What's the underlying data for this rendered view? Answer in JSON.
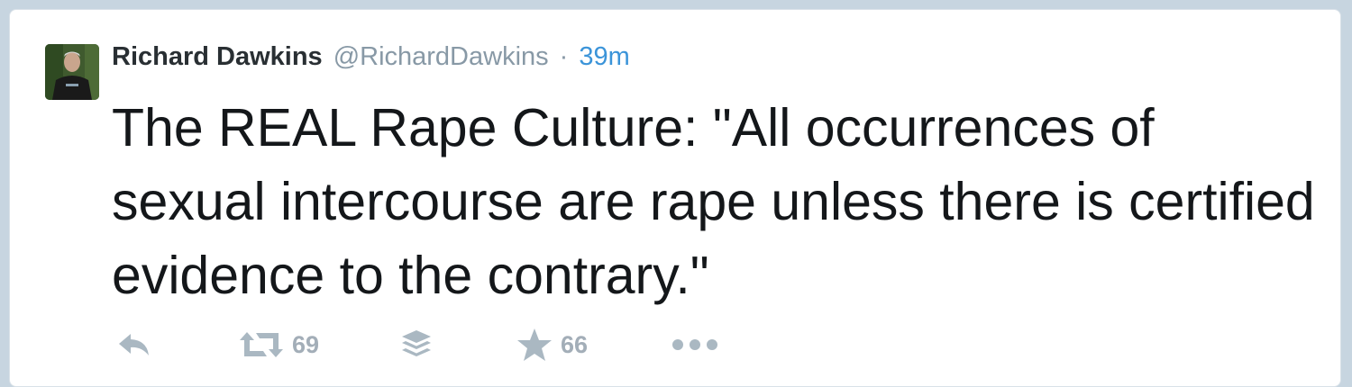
{
  "tweet": {
    "author": {
      "name": "Richard Dawkins",
      "handle": "@RichardDawkins"
    },
    "separator": "·",
    "time": "39m",
    "text": "The REAL Rape Culture: \"All occurrences of sexual intercourse are rape unless there is certified evidence to the contrary.\"",
    "actions": {
      "reply_icon": "reply-icon",
      "retweet_icon": "retweet-icon",
      "retweet_count": "69",
      "buffer_icon": "layers-icon",
      "favorite_icon": "star-icon",
      "favorite_count": "66",
      "more_icon": "more-dots-icon"
    },
    "colors": {
      "name": "#292f33",
      "handle": "#8899a6",
      "time_link": "#3b94d9",
      "text": "#14171a",
      "action_icons": "#aab8c2"
    }
  }
}
